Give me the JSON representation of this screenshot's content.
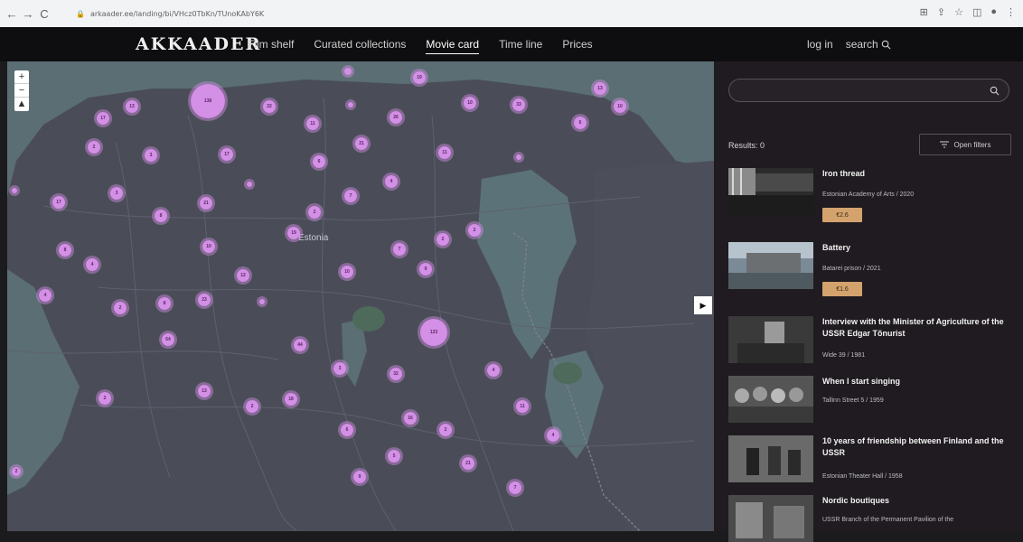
{
  "browser": {
    "url": "arkaader.ee/landing/bi/VHcz0TbKn/TUnoKAbY6K",
    "back_icon": "back-arrow-icon",
    "forward_icon": "forward-arrow-icon",
    "reload_icon": "reload-icon"
  },
  "header": {
    "logo": "AKKAADER",
    "nav": [
      "Film shelf",
      "Curated collections",
      "Movie card",
      "Time line",
      "Prices"
    ],
    "active_nav": "Movie card",
    "login": "log in",
    "search": "search"
  },
  "map": {
    "country_label": "Estonia",
    "zoom_in": "+",
    "zoom_out": "−",
    "compass": "▲",
    "cluster_color": "#d48fe6",
    "clusters": [
      {
        "label": "138"
      },
      {
        "label": "19"
      },
      {
        "label": "13"
      },
      {
        "label": "10"
      },
      {
        "label": "19"
      },
      {
        "label": "33"
      },
      {
        "label": "10"
      },
      {
        "label": "6"
      },
      {
        "label": "13"
      },
      {
        "label": "17"
      },
      {
        "label": "22"
      },
      {
        "label": "11"
      },
      {
        "label": "26"
      },
      {
        "label": "6"
      },
      {
        "label": "2"
      },
      {
        "label": "3"
      },
      {
        "label": "17"
      },
      {
        "label": "21"
      },
      {
        "label": "11"
      },
      {
        "label": "6"
      },
      {
        "label": "3"
      },
      {
        "label": "4"
      },
      {
        "label": "7"
      },
      {
        "label": "3"
      },
      {
        "label": "17"
      },
      {
        "label": "21"
      },
      {
        "label": "8"
      },
      {
        "label": "2"
      },
      {
        "label": "19"
      },
      {
        "label": "3"
      },
      {
        "label": "8"
      },
      {
        "label": "4"
      },
      {
        "label": "10"
      },
      {
        "label": "7"
      },
      {
        "label": "2"
      },
      {
        "label": "2"
      },
      {
        "label": "12"
      },
      {
        "label": "10"
      },
      {
        "label": "9"
      },
      {
        "label": "2"
      },
      {
        "label": "4"
      },
      {
        "label": "2"
      },
      {
        "label": "23"
      },
      {
        "label": "8"
      },
      {
        "label": "2"
      },
      {
        "label": "64"
      },
      {
        "label": "44"
      },
      {
        "label": "123"
      },
      {
        "label": "3"
      },
      {
        "label": "32"
      },
      {
        "label": "4"
      },
      {
        "label": "13"
      },
      {
        "label": "18"
      },
      {
        "label": "2"
      },
      {
        "label": "2"
      },
      {
        "label": "6"
      },
      {
        "label": "11"
      },
      {
        "label": "16"
      },
      {
        "label": "2"
      },
      {
        "label": "4"
      },
      {
        "label": "5"
      },
      {
        "label": "21"
      },
      {
        "label": "7"
      },
      {
        "label": "9"
      },
      {
        "label": "2"
      }
    ]
  },
  "sidebar": {
    "results_label": "Results: 0",
    "open_filters": "Open filters",
    "films": [
      {
        "title": "Iron thread",
        "meta": "Estonian Academy of Arts / 2020",
        "price": "€2.6"
      },
      {
        "title": "Battery",
        "meta": "Batarei prison / 2021",
        "price": "€1.6"
      },
      {
        "title": "Interview with the Minister of Agriculture of the USSR Edgar Tõnurist",
        "meta": "Wide 39 / 1981",
        "price": ""
      },
      {
        "title": "When I start singing",
        "meta": "Tallinn Street 5 / 1959",
        "price": ""
      },
      {
        "title": "10 years of friendship between Finland and the USSR",
        "meta": "Estonian Theater Hall / 1958",
        "price": ""
      },
      {
        "title": "Nordic boutiques",
        "meta": "USSR Branch of the Permanent Pavilion of the",
        "price": ""
      }
    ]
  }
}
